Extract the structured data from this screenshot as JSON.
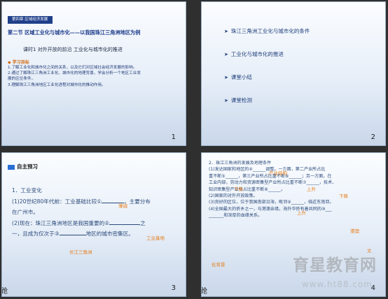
{
  "slides": {
    "s1": {
      "number": "1",
      "badge": "第四章  区域经济发展",
      "title": "第二节   区域工业化与城市化——以我国珠江三角洲地区为例",
      "subtitle": "课时1   对外开放的前沿    工业化与城市化的推进",
      "goals_heading": "◆ 学习目标",
      "goals": [
        "1.了解工业化和城市化之间的关系，以及它们对区域社会经济发展的影响。",
        "2.通过了解珠江三角洲工业化、城市化的地理背景，学会分析一个地区工业发",
        "   展的区位条件。",
        "3.理解珠江三角洲地区工业化进程对城市化的推动作用。"
      ]
    },
    "s2": {
      "number": "2",
      "items": [
        "珠江三角洲工业化与城市化的条件",
        "工业化与城市化的推进",
        "课堂小结",
        "课堂检测"
      ]
    },
    "s3": {
      "number": "3",
      "heading": "自主预习",
      "corner": "跄",
      "line1": "1．工业变化",
      "line2a": "(1)20世纪80年代前：工业基础比较①",
      "line2b": "，主要分布",
      "line3": "在广州市。",
      "line4a": "(2)现在：珠江三角洲地区是我国重要的②",
      "line4b": "之",
      "line5a": "一，且成为仅次于③",
      "line5b": "地区的城市密集区。",
      "ans1": "薄弱",
      "ans2": "工业基地",
      "ans3": "长江三角洲"
    },
    "s4": {
      "number": "4",
      "corner": "跄",
      "lines": [
        "2．珠江三角洲的发展及地理条件",
        "(1)发达国家和地区的④______调整。一方面，第二产业所占比",
        "重不断⑤______，第三产业所占比重不断⑥______；另一方面，在",
        "工业内部，劳动力和资源密集型产业所占比重不断⑦______，技术、",
        "知识密集型产业所占比重不断⑧______。",
        "(2)国家的对外开放政策。",
        "(3)良好的区位，位于我国南部沿海，毗邻⑨______，临近东南亚。",
        "(4)全国最大的侨乡之一，与港澳亲缘，海外华侨有着共同的⑩___",
        "_______和深厚的血缘关系。"
      ],
      "answers": [
        "产业结构",
        "下降",
        "上升",
        "下降",
        "上升",
        "港澳",
        "文",
        "化背景"
      ],
      "watermark": "育星教育网",
      "watermark_sub": "www.ht88.com"
    }
  }
}
